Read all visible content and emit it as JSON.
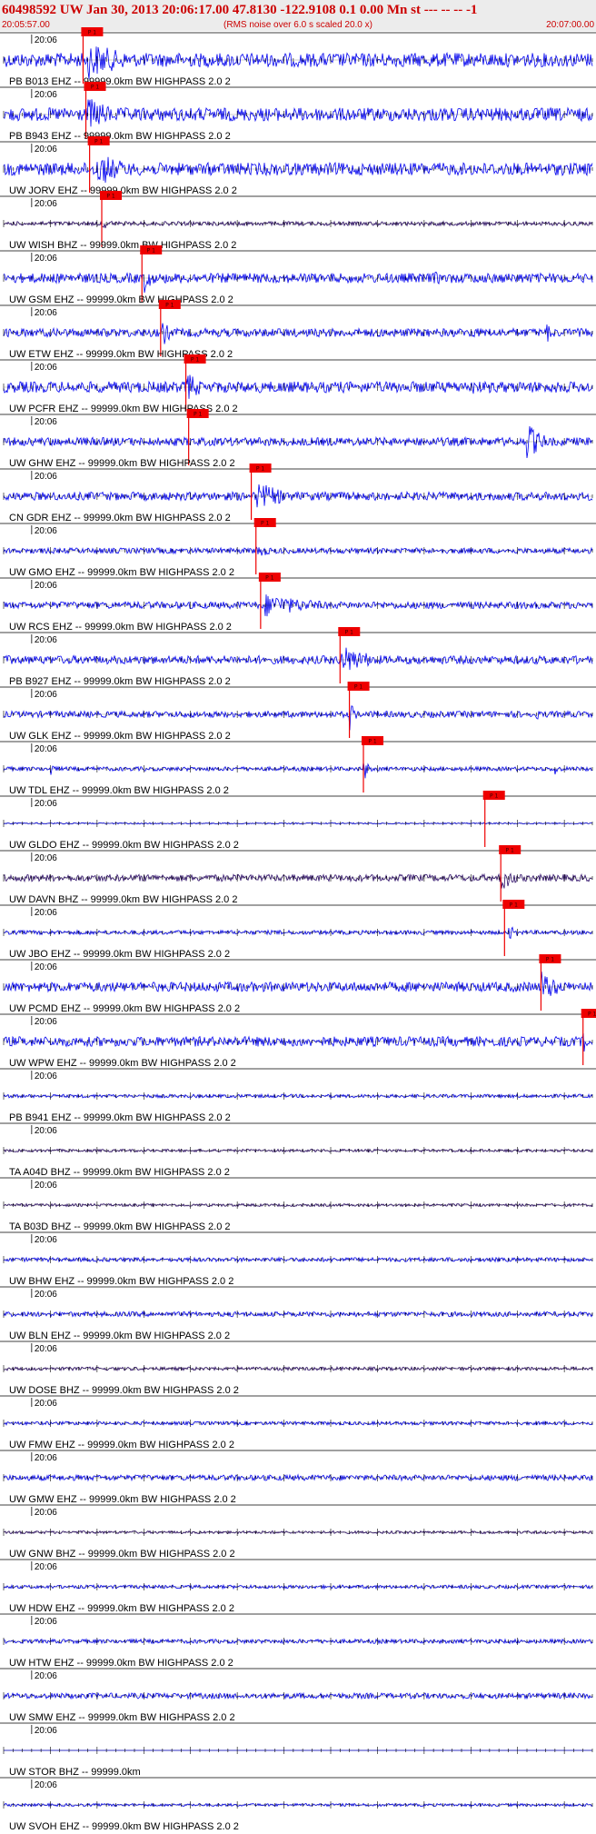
{
  "header": {
    "title": "60498592 UW Jan 30, 2013 20:06:17.00   47.8130 -122.9108  0.1 0.00 Mn st --- -- --  -1",
    "start_time": "20:05:57.00",
    "noise_note": "(RMS noise over 6.0 s scaled 20.0 x)",
    "end_time": "20:07:00.00"
  },
  "colors": {
    "trace_blue": "#0000ee",
    "trace_dark": "#2a0a66",
    "pick_red": "#ee0000",
    "header_red": "#cc0000"
  },
  "chart_data": {
    "type": "seismogram",
    "x_range_seconds": [
      0,
      63
    ],
    "minute_tick": "20:06",
    "pick_label": "P 1",
    "channels": [
      {
        "label": "PB B013 EHZ -- 99999.0km BW  HIGHPASS  2.0  2",
        "pick_s": 8.5,
        "color": "blue",
        "amp": 1.0,
        "bursts": [
          [
            9,
            22,
            1.0
          ]
        ]
      },
      {
        "label": "PB B943 EHZ -- 99999.0km BW  HIGHPASS  2.0  2",
        "pick_s": 8.8,
        "color": "blue",
        "amp": 0.95,
        "bursts": [
          [
            9,
            18,
            0.9
          ]
        ]
      },
      {
        "label": "UW JORV EHZ -- 99999.0km BW  HIGHPASS  2.0  2",
        "pick_s": 9.2,
        "color": "blue",
        "amp": 0.9,
        "bursts": [
          [
            10,
            20,
            0.9
          ]
        ]
      },
      {
        "label": "UW WISH BHZ -- 99999.0km BW  HIGHPASS  2.0  2",
        "pick_s": 10.5,
        "color": "dark",
        "amp": 0.3,
        "bursts": [
          [
            10.5,
            15,
            0.3
          ]
        ]
      },
      {
        "label": "UW GSM EHZ -- 99999.0km BW  HIGHPASS  2.0  2",
        "pick_s": 14.8,
        "color": "blue",
        "amp": 0.7,
        "bursts": [
          [
            15,
            18,
            0.8
          ],
          [
            46,
            49,
            0.5
          ]
        ]
      },
      {
        "label": "UW ETW EHZ -- 99999.0km BW  HIGHPASS  2.0  2",
        "pick_s": 16.8,
        "color": "blue",
        "amp": 0.6,
        "bursts": [
          [
            17,
            20,
            0.7
          ],
          [
            50,
            52,
            0.5
          ],
          [
            58,
            61,
            0.6
          ]
        ]
      },
      {
        "label": "UW PCFR EHZ -- 99999.0km BW  HIGHPASS  2.0  2",
        "pick_s": 19.5,
        "color": "blue",
        "amp": 0.8,
        "bursts": [
          [
            19.5,
            24,
            0.9
          ],
          [
            50,
            53,
            0.5
          ]
        ]
      },
      {
        "label": "UW GHW EHZ -- 99999.0km BW  HIGHPASS  2.0  2",
        "pick_s": 19.8,
        "color": "blue",
        "amp": 0.6,
        "bursts": [
          [
            56,
            61,
            1.0
          ]
        ]
      },
      {
        "label": "CN GDR EHZ -- 99999.0km BW  HIGHPASS  2.0  2",
        "pick_s": 26.5,
        "color": "blue",
        "amp": 0.6,
        "bursts": [
          [
            27,
            36,
            0.8
          ]
        ]
      },
      {
        "label": "UW GMO EHZ -- 99999.0km BW  HIGHPASS  2.0  2",
        "pick_s": 27.0,
        "color": "blue",
        "amp": 0.4,
        "bursts": [
          [
            27,
            32,
            0.4
          ]
        ]
      },
      {
        "label": "UW RCS EHZ -- 99999.0km BW  HIGHPASS  2.0  2",
        "pick_s": 27.5,
        "color": "blue",
        "amp": 0.5,
        "bursts": [
          [
            28,
            45,
            0.6
          ]
        ]
      },
      {
        "label": "PB B927 EHZ -- 99999.0km BW  HIGHPASS  2.0  2",
        "pick_s": 36.0,
        "color": "blue",
        "amp": 0.6,
        "bursts": [
          [
            36,
            46,
            0.8
          ]
        ]
      },
      {
        "label": "UW GLK EHZ -- 99999.0km BW  HIGHPASS  2.0  2",
        "pick_s": 37.0,
        "color": "blue",
        "amp": 0.45,
        "bursts": [
          [
            37,
            38.5,
            0.9
          ],
          [
            19,
            20,
            0.4
          ],
          [
            57,
            58,
            0.4
          ]
        ]
      },
      {
        "label": "UW TDL EHZ -- 99999.0km BW  HIGHPASS  2.0  2",
        "pick_s": 38.5,
        "color": "blue",
        "amp": 0.3,
        "bursts": [
          [
            38.5,
            40,
            0.7
          ],
          [
            5,
            6,
            0.5
          ],
          [
            59,
            60,
            0.5
          ]
        ]
      },
      {
        "label": "UW GLDO EHZ -- 99999.0km BW  HIGHPASS  2.0  2",
        "pick_s": 51.5,
        "color": "blue",
        "amp": 0.1,
        "bursts": []
      },
      {
        "label": "UW DAVN BHZ -- 99999.0km BW  HIGHPASS  2.0  2",
        "pick_s": 53.2,
        "color": "dark",
        "amp": 0.5,
        "bursts": [
          [
            53,
            57,
            0.9
          ]
        ]
      },
      {
        "label": "UW JBO EHZ -- 99999.0km BW  HIGHPASS  2.0  2",
        "pick_s": 53.6,
        "color": "blue",
        "amp": 0.3,
        "bursts": [
          [
            54,
            57,
            0.4
          ]
        ]
      },
      {
        "label": "UW PCMD EHZ -- 99999.0km BW  HIGHPASS  2.0  2",
        "pick_s": 57.5,
        "color": "blue",
        "amp": 0.7,
        "bursts": [
          [
            57.5,
            63,
            0.9
          ]
        ]
      },
      {
        "label": "UW WPW EHZ -- 99999.0km BW  HIGHPASS  2.0  2",
        "pick_s": 62.0,
        "color": "blue",
        "amp": 0.7,
        "bursts": [
          [
            62,
            63,
            0.8
          ]
        ]
      },
      {
        "label": "PB B941 EHZ -- 99999.0km BW  HIGHPASS  2.0  2",
        "pick_s": null,
        "color": "blue",
        "amp": 0.25,
        "bursts": []
      },
      {
        "label": "TA A04D BHZ -- 99999.0km BW  HIGHPASS  2.0  2",
        "pick_s": null,
        "color": "dark",
        "amp": 0.2,
        "bursts": []
      },
      {
        "label": "TA B03D BHZ -- 99999.0km BW  HIGHPASS  2.0  2",
        "pick_s": null,
        "color": "dark",
        "amp": 0.2,
        "bursts": []
      },
      {
        "label": "UW BHW EHZ -- 99999.0km BW  HIGHPASS  2.0  2",
        "pick_s": null,
        "color": "blue",
        "amp": 0.3,
        "bursts": []
      },
      {
        "label": "UW BLN EHZ -- 99999.0km BW  HIGHPASS  2.0  2",
        "pick_s": null,
        "color": "blue",
        "amp": 0.35,
        "bursts": []
      },
      {
        "label": "UW DOSE BHZ -- 99999.0km BW  HIGHPASS  2.0  2",
        "pick_s": null,
        "color": "dark",
        "amp": 0.25,
        "bursts": []
      },
      {
        "label": "UW FMW EHZ -- 99999.0km BW  HIGHPASS  2.0  2",
        "pick_s": null,
        "color": "blue",
        "amp": 0.25,
        "bursts": []
      },
      {
        "label": "UW GMW EHZ -- 99999.0km BW  HIGHPASS  2.0  2",
        "pick_s": null,
        "color": "blue",
        "amp": 0.4,
        "bursts": []
      },
      {
        "label": "UW GNW BHZ -- 99999.0km BW  HIGHPASS  2.0  2",
        "pick_s": null,
        "color": "dark",
        "amp": 0.2,
        "bursts": []
      },
      {
        "label": "UW HDW EHZ -- 99999.0km BW  HIGHPASS  2.0  2",
        "pick_s": null,
        "color": "blue",
        "amp": 0.25,
        "bursts": []
      },
      {
        "label": "UW HTW EHZ -- 99999.0km BW  HIGHPASS  2.0  2",
        "pick_s": null,
        "color": "blue",
        "amp": 0.3,
        "bursts": []
      },
      {
        "label": "UW SMW EHZ -- 99999.0km BW  HIGHPASS  2.0  2",
        "pick_s": null,
        "color": "blue",
        "amp": 0.4,
        "bursts": []
      },
      {
        "label": "UW STOR BHZ -- 99999.0km",
        "pick_s": null,
        "color": "blue",
        "amp": 0.0,
        "bursts": []
      },
      {
        "label": "UW SVOH EHZ -- 99999.0km BW  HIGHPASS  2.0  2",
        "pick_s": null,
        "color": "blue",
        "amp": 0.2,
        "bursts": []
      }
    ]
  }
}
